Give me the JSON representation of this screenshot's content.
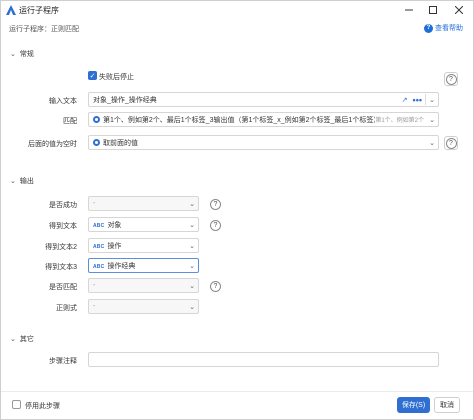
{
  "window": {
    "title": "运行子程序",
    "breadcrumb": "运行子程序：正则匹配",
    "help_label": "查看帮助"
  },
  "sections": {
    "general": "常规",
    "output": "输出",
    "other": "其它"
  },
  "general": {
    "stop_on_fail_label": "失败后停止",
    "stop_on_fail_checked": true,
    "input_text_label": "输入文本",
    "input_text_value": "对象_操作_操作经典",
    "match_label": "匹配",
    "match_value": "第1个、例如第2个、最后1个标签_3输出值（第1个标签_x_例如第2个标签_最后1个标签）",
    "match_hint": "第1个、例如第2个",
    "empty_value_label": "后面的值为空时",
    "empty_value_value": "取前面的值"
  },
  "output": {
    "success_label": "是否成功",
    "success_value": "-",
    "text_label": "得到文本",
    "text_value": "对象",
    "text2_label": "得到文本2",
    "text2_value": "操作",
    "text3_label": "得到文本3",
    "text3_value": "操作经典",
    "match_label": "是否匹配",
    "match_value": "-",
    "regex_label": "正则式",
    "regex_value": "-",
    "abc_tag": "ABC"
  },
  "other": {
    "step_note_label": "步骤注释",
    "step_note_value": ""
  },
  "footer": {
    "disable_step_label": "停用此步骤",
    "save_label": "保存(S)",
    "cancel_label": "取消"
  },
  "colors": {
    "accent": "#2f6fd1"
  }
}
